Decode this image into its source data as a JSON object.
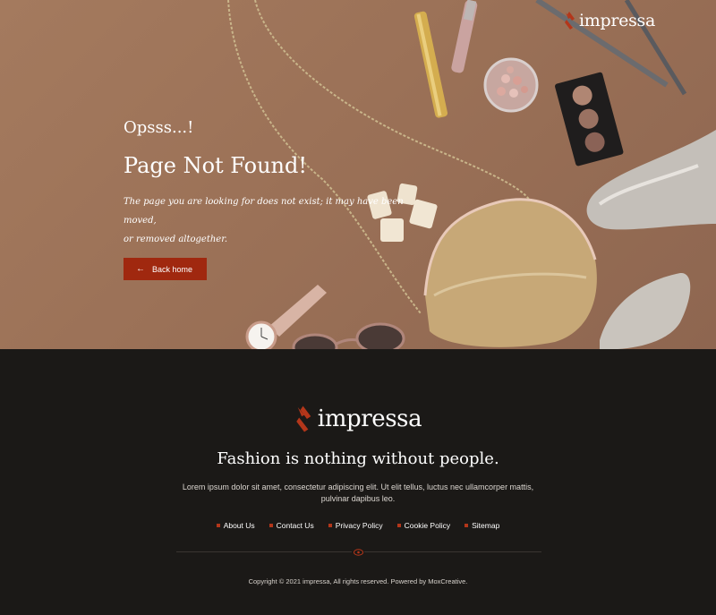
{
  "header": {
    "brand": "impressa"
  },
  "hero": {
    "eyebrow": "Opsss...!",
    "title": "Page Not Found!",
    "text_line1": "The page you are looking for does not exist; it may have been moved,",
    "text_line2": "or removed altogether.",
    "button_label": "Back home",
    "button_arrow": "←"
  },
  "footer": {
    "brand": "impressa",
    "tagline": "Fashion is nothing without people.",
    "description": "Lorem ipsum dolor sit amet, consectetur adipiscing elit. Ut elit tellus, luctus nec ullamcorper mattis, pulvinar dapibus leo.",
    "links": [
      "About Us",
      "Contact Us",
      "Privacy Policy",
      "Cookie Policy",
      "Sitemap"
    ],
    "copyright": "Copyright © 2021 impressa, All rights reserved. Powered by MoxCreative."
  },
  "colors": {
    "accent": "#a0280f",
    "hero_bg": "#9b7157",
    "footer_bg": "#1b1917"
  },
  "icons": {
    "logo": "logo-mark-icon",
    "back": "arrow-left-icon",
    "divider": "eye-icon"
  }
}
